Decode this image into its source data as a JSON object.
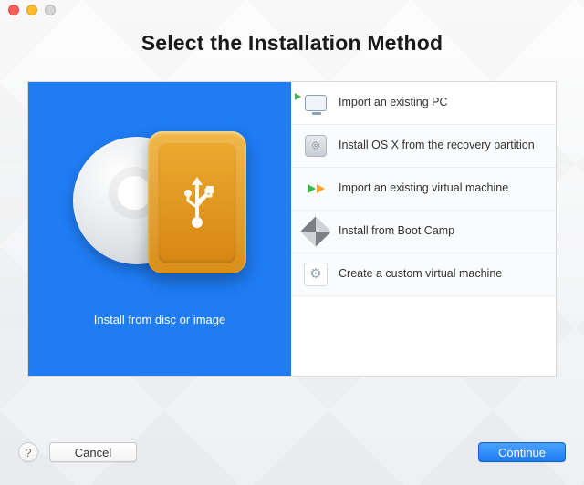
{
  "window": {
    "heading": "Select the Installation Method"
  },
  "hero": {
    "caption": "Install from disc or image"
  },
  "options": [
    {
      "id": "import-pc",
      "label": "Import an existing PC",
      "icon": "monitor-import-icon",
      "selected": true
    },
    {
      "id": "install-osx",
      "label": "Install OS X from the recovery partition",
      "icon": "harddrive-icon",
      "selected": false
    },
    {
      "id": "import-vm",
      "label": "Import an existing virtual machine",
      "icon": "double-arrow-icon",
      "selected": false
    },
    {
      "id": "bootcamp",
      "label": "Install from Boot Camp",
      "icon": "bootcamp-icon",
      "selected": false
    },
    {
      "id": "custom-vm",
      "label": "Create a custom virtual machine",
      "icon": "gear-icon",
      "selected": false
    }
  ],
  "footer": {
    "help": "?",
    "cancel": "Cancel",
    "continue": "Continue"
  }
}
